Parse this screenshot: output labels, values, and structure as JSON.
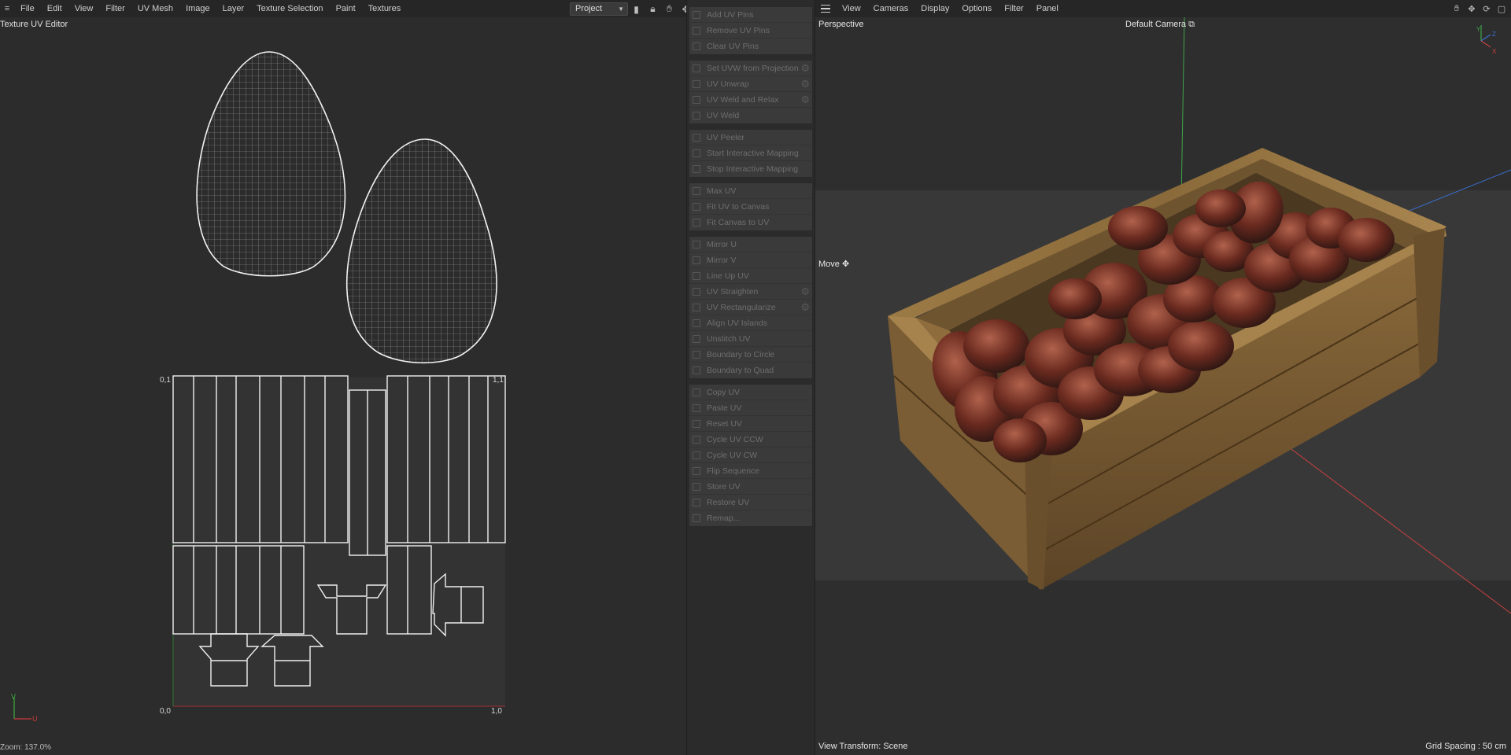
{
  "uv_editor": {
    "menu": [
      "File",
      "Edit",
      "View",
      "Filter",
      "UV Mesh",
      "Image",
      "Layer",
      "Texture Selection",
      "Paint",
      "Textures"
    ],
    "title": "Texture UV Editor",
    "project_select": "Project",
    "tool_icons": [
      "histogram-icon",
      "lock-icon",
      "hand-pan-icon",
      "move-icon"
    ],
    "coords": {
      "top_left": "0,1",
      "top_right": "1,1",
      "bottom_left": "0,0",
      "bottom_right": "1,0"
    },
    "axis": {
      "v": "V",
      "u": "U"
    },
    "zoom": "Zoom: 137.0%"
  },
  "uv_commands": {
    "groups": [
      [
        {
          "label": "Add UV Pins",
          "icon": "pin-add-icon"
        },
        {
          "label": "Remove UV Pins",
          "icon": "pin-remove-icon"
        },
        {
          "label": "Clear UV Pins",
          "icon": "pin-clear-icon"
        }
      ],
      [
        {
          "label": "Set UVW from Projection",
          "icon": "projection-icon",
          "gear": true
        },
        {
          "label": "UV Unwrap",
          "icon": "unwrap-icon",
          "gear": true
        },
        {
          "label": "UV Weld and Relax",
          "icon": "weld-relax-icon",
          "gear": true
        },
        {
          "label": "UV Weld",
          "icon": "weld-icon"
        }
      ],
      [
        {
          "label": "UV Peeler",
          "icon": "peeler-icon"
        },
        {
          "label": "Start Interactive Mapping",
          "icon": "play-icon"
        },
        {
          "label": "Stop Interactive Mapping",
          "icon": "stop-icon"
        }
      ],
      [
        {
          "label": "Max UV",
          "icon": "max-uv-icon"
        },
        {
          "label": "Fit UV to Canvas",
          "icon": "fit-uv-icon"
        },
        {
          "label": "Fit Canvas to UV",
          "icon": "fit-canvas-icon"
        }
      ],
      [
        {
          "label": "Mirror U",
          "icon": "mirror-u-icon"
        },
        {
          "label": "Mirror V",
          "icon": "mirror-v-icon"
        },
        {
          "label": "Line Up UV",
          "icon": "line-up-icon"
        },
        {
          "label": "UV Straighten",
          "icon": "straighten-icon",
          "gear": true
        },
        {
          "label": "UV Rectangularize",
          "icon": "rectangularize-icon",
          "gear": true
        },
        {
          "label": "Align UV Islands",
          "icon": "align-icon"
        },
        {
          "label": "Unstitch UV",
          "icon": "unstitch-icon"
        },
        {
          "label": "Boundary to Circle",
          "icon": "circle-icon"
        },
        {
          "label": "Boundary to Quad",
          "icon": "quad-icon"
        }
      ],
      [
        {
          "label": "Copy UV",
          "icon": "copy-icon"
        },
        {
          "label": "Paste UV",
          "icon": "paste-icon"
        },
        {
          "label": "Reset UV",
          "icon": "reset-icon"
        },
        {
          "label": "Cycle UV CCW",
          "icon": "cycle-ccw-icon"
        },
        {
          "label": "Cycle UV CW",
          "icon": "cycle-cw-icon"
        },
        {
          "label": "Flip Sequence",
          "icon": "flip-icon"
        },
        {
          "label": "Store UV",
          "icon": "store-icon"
        },
        {
          "label": "Restore UV",
          "icon": "restore-icon"
        },
        {
          "label": "Remap...",
          "icon": "remap-icon"
        }
      ]
    ]
  },
  "viewport": {
    "menu": [
      "View",
      "Cameras",
      "Display",
      "Options",
      "Filter",
      "Panel"
    ],
    "perspective_label": "Perspective",
    "camera_label": "Default Camera",
    "move_label": "Move",
    "view_transform": "View Transform: Scene",
    "grid_spacing": "Grid Spacing : 50 cm",
    "tool_icons": [
      "hand-pan-icon",
      "move-icon",
      "rotate-icon",
      "maximize-icon"
    ],
    "axis_gizmo": {
      "y": "Y",
      "z": "Z",
      "x": "X"
    },
    "colors": {
      "background": "#2e2e2e",
      "floor": "#3a3a3a",
      "wood": "#8a6a3e",
      "fruit": "#6e2a20"
    }
  }
}
